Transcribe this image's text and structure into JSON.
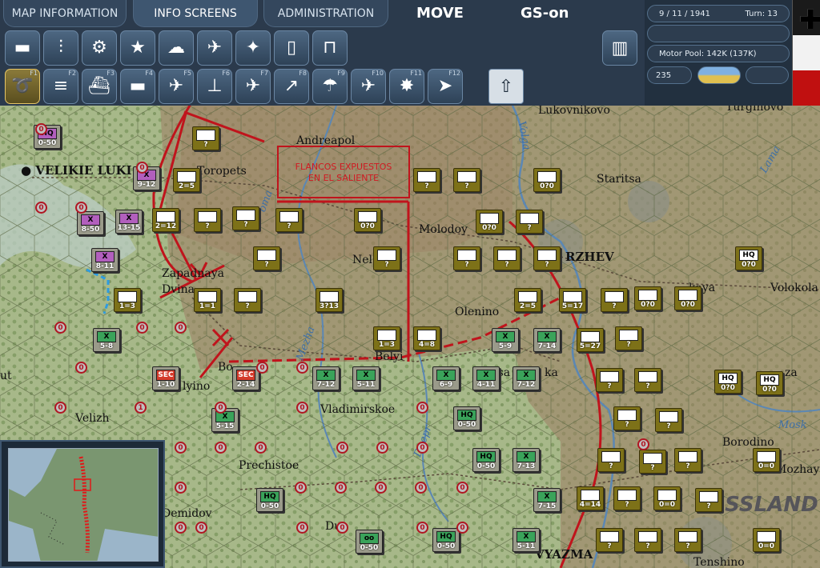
{
  "tabs": {
    "map_info": "MAP INFORMATION",
    "info_screens": "INFO SCREENS",
    "administration": "ADMINISTRATION"
  },
  "mode": {
    "phase": "MOVE",
    "gs": "GS-on"
  },
  "toolbar_top": [
    {
      "icon": "tank-icon",
      "label": "Ground units"
    },
    {
      "icon": "formation-icon",
      "label": "Formations"
    },
    {
      "icon": "gear-icon",
      "label": "Production"
    },
    {
      "icon": "star-icon",
      "label": "Victory"
    },
    {
      "icon": "weather-icon",
      "label": "Weather"
    },
    {
      "icon": "air-icon",
      "label": "Air"
    },
    {
      "icon": "satellite-icon",
      "label": "Air recon"
    },
    {
      "icon": "fuel-icon",
      "label": "Supply"
    },
    {
      "icon": "rail-icon",
      "label": "Rail"
    }
  ],
  "toolbar_bottom": [
    {
      "icon": "move-icon",
      "fkey": "F1"
    },
    {
      "icon": "rail-move-icon",
      "fkey": "F2"
    },
    {
      "icon": "naval-icon",
      "fkey": "F3"
    },
    {
      "icon": "naval-transport-icon",
      "fkey": "F4"
    },
    {
      "icon": "air-attack-icon",
      "fkey": "F5"
    },
    {
      "icon": "artillery-icon",
      "fkey": "F6"
    },
    {
      "icon": "air-transfer-icon",
      "fkey": "F7"
    },
    {
      "icon": "bombard-icon",
      "fkey": "F8"
    },
    {
      "icon": "paradrop-icon",
      "fkey": "F9"
    },
    {
      "icon": "strategic-bomb-icon",
      "fkey": "F10"
    },
    {
      "icon": "explosion-icon",
      "fkey": "F11"
    },
    {
      "icon": "next-unit-icon",
      "fkey": "F12"
    }
  ],
  "info": {
    "date": "9 / 11 / 1941",
    "turn": "Turn: 13",
    "motor_pool": "Motor Pool: 142K (137K)",
    "count": "235"
  },
  "annotation": "FLANCOS EXPUESTOS\nEN EL SALIENTE",
  "cities": [
    {
      "name": "VELIKIE LUKI"
    },
    {
      "name": "Toropets"
    },
    {
      "name": "Andreapol"
    },
    {
      "name": "Staritsa"
    },
    {
      "name": "RZHEV"
    },
    {
      "name": "Molodoy"
    },
    {
      "name": "Nelidovo"
    },
    {
      "name": "Zapadnaya Dvina"
    },
    {
      "name": "Olenino"
    },
    {
      "name": "Belyi"
    },
    {
      "name": "Bor"
    },
    {
      "name": "Dukhovshchina"
    },
    {
      "name": "Velizh"
    },
    {
      "name": "Vladimirskoe"
    },
    {
      "name": "Prechistoe"
    },
    {
      "name": "Demidov"
    },
    {
      "name": "Dur"
    },
    {
      "name": "Borodino"
    },
    {
      "name": "Mozhaysk"
    },
    {
      "name": "Volokolamsk"
    },
    {
      "name": "Lukovnikovo"
    },
    {
      "name": "Turginovo"
    },
    {
      "name": "VYAZMA"
    },
    {
      "name": "Tsarevo"
    },
    {
      "name": "Tenshino"
    },
    {
      "name": "Sychevka"
    },
    {
      "name": "Novoduginskaya"
    },
    {
      "name": "Ruza"
    }
  ],
  "cities_text": {
    "velikie": "VELIKIE LUKI",
    "toropets": "Toropets",
    "andreapol": "Andreapol",
    "staritsa": "Staritsa",
    "rzhev": "RZHEV",
    "molodoy": "Molodoy",
    "nel": "Nel",
    "zapadnaya": "Zapadnaya",
    "dvina": "Dvina",
    "olenino": "Olenino",
    "belyi": "Belyi",
    "bor": "Bo",
    "dukh": "lyino",
    "velizh": "Velizh",
    "vladi": "Vladimirskoe",
    "prechistoe": "Prechistoe",
    "demidov": "Demidov",
    "dur": "Dur",
    "borodino": "Borodino",
    "mozhay": "Mozhay",
    "volokol": "Volokola",
    "lukov": "Lukovnikovo",
    "turgin": "Turginovo",
    "vyazma": "VYAZMA",
    "tsa": "tsa",
    "tenshino": "Tenshino",
    "novodug": "kaya",
    "ruza": "za",
    "ut": "ut",
    "ka": "ka",
    "ruski": "USSLAND",
    "nel2": "N",
    "ru2": "R"
  },
  "rivers": {
    "volga": "Volga",
    "lama": "Lama",
    "mezha": "Mezha",
    "dnepr": "Dnepr",
    "moskva": "Mosk",
    "doma": "oma"
  },
  "axis_units": [
    {
      "sym": "HQ",
      "str": "0-50",
      "type": "purple"
    },
    {
      "sym": "X",
      "str": "9-12",
      "type": "purple"
    },
    {
      "sym": "X",
      "str": "8-50",
      "type": "purple"
    },
    {
      "sym": "X",
      "str": "13-15",
      "type": "purple"
    },
    {
      "sym": "X",
      "str": "8-11",
      "type": "purple"
    },
    {
      "sym": "X",
      "str": "5-8",
      "type": "green"
    },
    {
      "sym": "SEC",
      "str": "1-10",
      "type": "red"
    },
    {
      "sym": "SEC",
      "str": "2-14",
      "type": "red"
    },
    {
      "sym": "X",
      "str": "7-12",
      "type": "green"
    },
    {
      "sym": "X",
      "str": "5-11",
      "type": "green"
    },
    {
      "sym": "X",
      "str": "6-9",
      "type": "green"
    },
    {
      "sym": "X",
      "str": "4-11",
      "type": "green"
    },
    {
      "sym": "X",
      "str": "7-12",
      "type": "green"
    },
    {
      "sym": "X",
      "str": "5-9",
      "type": "green"
    },
    {
      "sym": "X",
      "str": "7-14",
      "type": "green"
    },
    {
      "sym": "HQ",
      "str": "0-50",
      "type": "green"
    },
    {
      "sym": "X",
      "str": "5-15",
      "type": "green"
    },
    {
      "sym": "HQ",
      "str": "0-50",
      "type": "green"
    },
    {
      "sym": "X",
      "str": "7-13",
      "type": "green"
    },
    {
      "sym": "HQ",
      "str": "0-50",
      "type": "green"
    },
    {
      "sym": "X",
      "str": "7-15",
      "type": "green"
    },
    {
      "sym": "oo",
      "str": "0-50",
      "type": "green"
    },
    {
      "sym": "HQ",
      "str": "0-50",
      "type": "green"
    },
    {
      "sym": "X",
      "str": "5-11",
      "type": "green"
    }
  ],
  "sov_units": [
    {
      "str": "2=5"
    },
    {
      "str": "?"
    },
    {
      "str": "2=12"
    },
    {
      "str": "?"
    },
    {
      "str": "?"
    },
    {
      "str": "?"
    },
    {
      "str": "?"
    },
    {
      "str": "?"
    },
    {
      "str": "0?0"
    },
    {
      "str": "?"
    },
    {
      "str": "?"
    },
    {
      "str": "0?0"
    },
    {
      "str": "0?0"
    },
    {
      "str": "?"
    },
    {
      "str": "?"
    },
    {
      "str": "?"
    },
    {
      "str": "?"
    },
    {
      "str": "?"
    },
    {
      "str": "3?13"
    },
    {
      "str": "1=3"
    },
    {
      "str": "1=1"
    },
    {
      "str": "?"
    },
    {
      "str": "0?0"
    },
    {
      "str": "2=5"
    },
    {
      "str": "5=17"
    },
    {
      "str": "?"
    },
    {
      "str": "0?0"
    },
    {
      "str": "0?0"
    },
    {
      "str": "1=3"
    },
    {
      "str": "4=8"
    },
    {
      "str": "5=27"
    },
    {
      "str": "?"
    },
    {
      "str": "?"
    },
    {
      "str": "?"
    },
    {
      "str": "0?0"
    },
    {
      "str": "0?0"
    },
    {
      "str": "?"
    },
    {
      "str": "?"
    },
    {
      "str": "?"
    },
    {
      "str": "?"
    },
    {
      "str": "0=0"
    },
    {
      "str": "?"
    },
    {
      "str": "?"
    },
    {
      "str": "?"
    },
    {
      "str": "?"
    },
    {
      "str": "0=0"
    },
    {
      "str": "4=14"
    },
    {
      "str": "?"
    },
    {
      "str": "?"
    },
    {
      "str": "?"
    },
    {
      "str": "0=0"
    },
    {
      "str": "?"
    }
  ],
  "sov_hq_label": "HQ"
}
